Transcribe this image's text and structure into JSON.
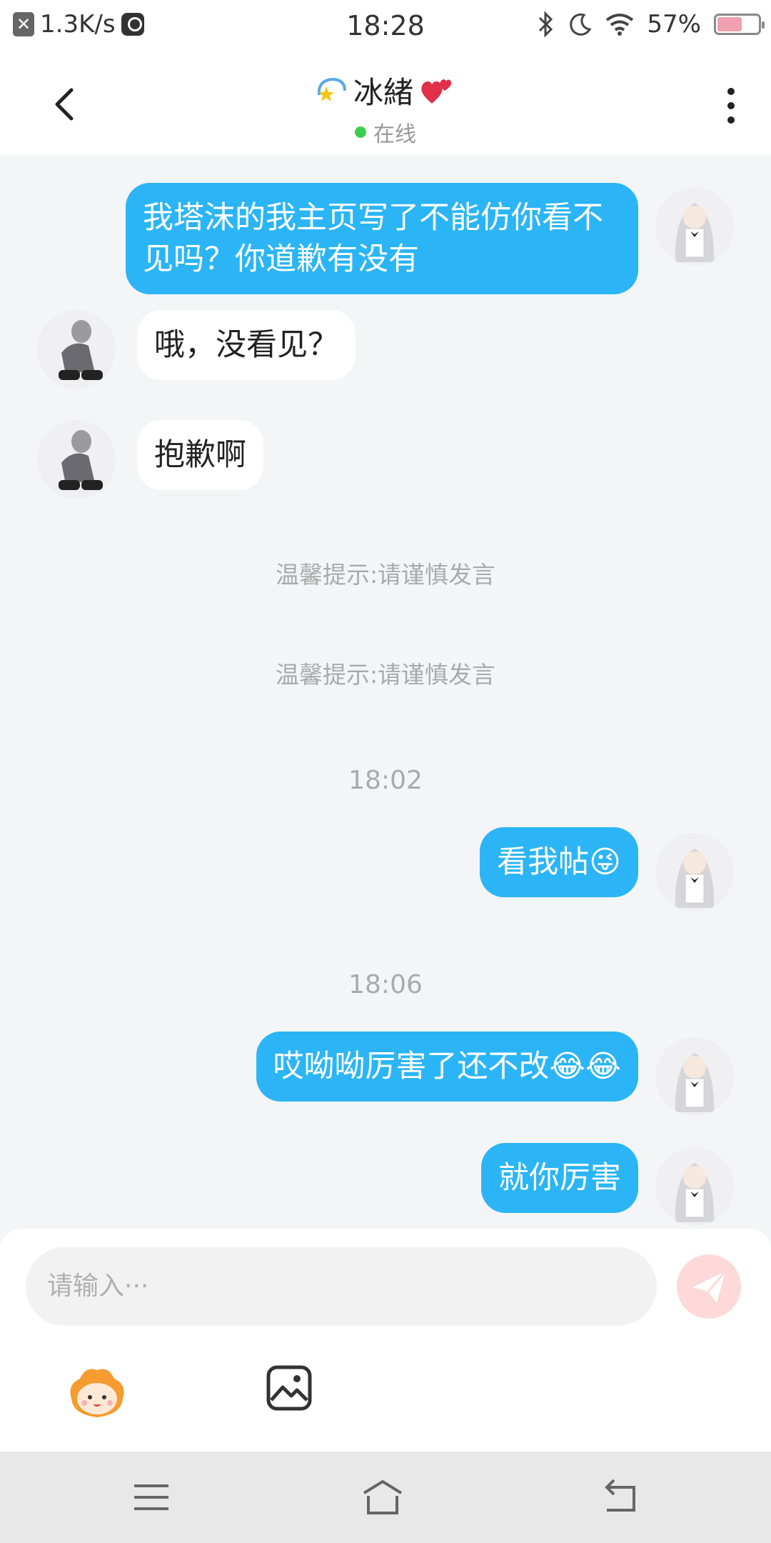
{
  "status_bar": {
    "speed": "1.3K/s",
    "time": "18:28",
    "battery": "57%"
  },
  "header": {
    "name": "冰緒",
    "status": "在线"
  },
  "messages": [
    {
      "side": "out",
      "text": "我塔沫的我主页写了不能仿你看不见吗？你道歉有没有"
    },
    {
      "side": "in",
      "text": "哦，没看见？"
    },
    {
      "side": "in",
      "text": "抱歉啊"
    },
    {
      "side": "out",
      "text": "看我帖😜"
    },
    {
      "side": "out",
      "text": "哎呦呦厉害了还不改😂😂"
    },
    {
      "side": "out",
      "text": "就你厉害"
    }
  ],
  "notices": [
    "温馨提示:请谨慎发言",
    "温馨提示:请谨慎发言"
  ],
  "timestamps": [
    "18:02",
    "18:06"
  ],
  "input": {
    "placeholder": "请输入···"
  },
  "colors": {
    "bubble_out": "#2bb5f6",
    "bubble_in": "#ffffff",
    "online_dot": "#3ccf4e",
    "send_button": "#fdd9d9"
  },
  "icons": {
    "back": "chevron-left-icon",
    "more": "more-vertical-icon",
    "send": "send-icon",
    "emoji": "emoji-mascot-icon",
    "image": "image-icon",
    "nav_menu": "menu-icon",
    "nav_home": "home-icon",
    "nav_back": "back-icon"
  }
}
